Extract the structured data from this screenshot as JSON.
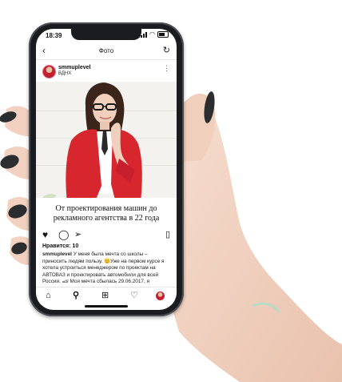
{
  "status": {
    "time": "18:39"
  },
  "header": {
    "title": "Фото"
  },
  "post": {
    "username": "smmuplevel",
    "location": "ВДНХ",
    "image_title": "От проектирования машин до рекламного агентства в 22 года",
    "likes": "Нравится: 10",
    "description_user": "smmuplevel",
    "description_text": " У меня была мечта со школы – приносить людям пользу. 😊Уже на первом курсе я хотела устроиться менеджером по проектам на АВТОВАЗ и проектировать автомобили для всей России. 🏎 Моя мечта сбылась 29.06.2017, я"
  },
  "icons": {
    "back": "chevron-left-icon",
    "refresh": "refresh-icon",
    "more": "more-dots-icon",
    "like": "heart-filled-icon",
    "comment": "comment-icon",
    "share": "send-icon",
    "save": "bookmark-icon",
    "tab_home": "home-icon",
    "tab_search": "search-icon",
    "tab_add": "add-post-icon",
    "tab_activity": "heart-outline-icon",
    "tab_profile": "profile-avatar-icon"
  },
  "colors": {
    "jacket": "#d8262f",
    "phone": "#1b1c1f",
    "skin": "#f0d3c2",
    "nails": "#2b2d2f"
  }
}
